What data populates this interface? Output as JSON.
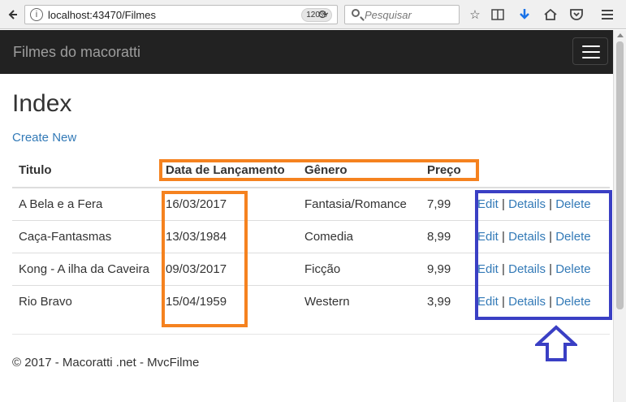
{
  "browser": {
    "url": "localhost:43470/Filmes",
    "zoom": "120%",
    "search_placeholder": "Pesquisar"
  },
  "navbar": {
    "brand": "Filmes do macoratti"
  },
  "page": {
    "title": "Index",
    "create_link": "Create New"
  },
  "table": {
    "headers": [
      "Titulo",
      "Data de Lançamento",
      "Gênero",
      "Preço"
    ],
    "rows": [
      {
        "title": "A Bela e a Fera",
        "date": "16/03/2017",
        "genre": "Fantasia/Romance",
        "price": "7,99"
      },
      {
        "title": "Caça-Fantasmas",
        "date": "13/03/1984",
        "genre": "Comedia",
        "price": "8,99"
      },
      {
        "title": "Kong - A ilha da Caveira",
        "date": "09/03/2017",
        "genre": "Ficção",
        "price": "9,99"
      },
      {
        "title": "Rio Bravo",
        "date": "15/04/1959",
        "genre": "Western",
        "price": "3,99"
      }
    ],
    "actions": {
      "edit": "Edit",
      "details": "Details",
      "delete": "Delete",
      "separator": "|"
    }
  },
  "footer": {
    "text": "© 2017 - Macoratti .net - MvcFilme"
  },
  "colors": {
    "navbar_bg": "#222222",
    "link": "#337ab7",
    "annotation_orange": "#f5821f",
    "annotation_blue": "#3a3fc4"
  },
  "icons": [
    "back-icon",
    "info-icon",
    "reload-icon",
    "search-icon",
    "bookmark-star-icon",
    "reading-list-icon",
    "download-icon",
    "home-icon",
    "pocket-icon",
    "menu-icon",
    "hamburger-icon",
    "up-arrow-icon"
  ]
}
